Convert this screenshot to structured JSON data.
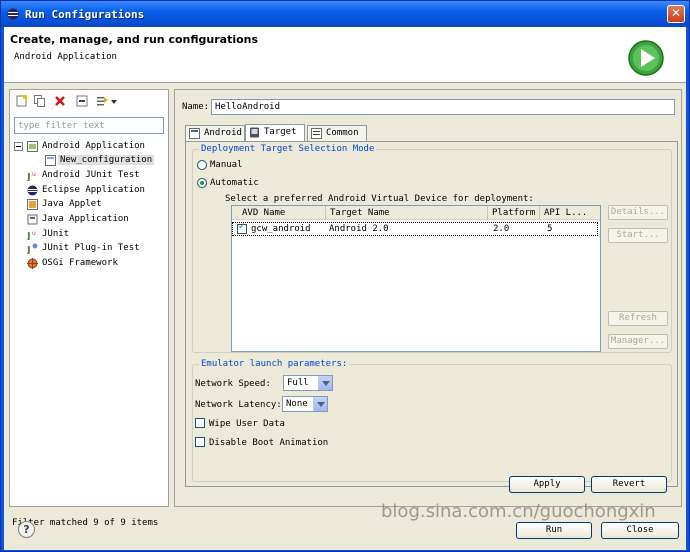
{
  "window": {
    "title": "Run Configurations",
    "close_symbol": "✕"
  },
  "header": {
    "title": "Create, manage, and run configurations",
    "subtitle": "Android Application"
  },
  "left": {
    "filter_placeholder": "type filter text",
    "tree": [
      {
        "label": "Android Application",
        "icon": "android-app-icon",
        "indent": 1,
        "expanded": true
      },
      {
        "label": "New_configuration",
        "icon": "config-icon",
        "indent": 2,
        "selected": true
      },
      {
        "label": "Android JUnit Test",
        "icon": "junit-icon",
        "indent": 1
      },
      {
        "label": "Eclipse Application",
        "icon": "eclipse-icon",
        "indent": 1
      },
      {
        "label": "Java Applet",
        "icon": "applet-icon",
        "indent": 1
      },
      {
        "label": "Java Application",
        "icon": "java-app-icon",
        "indent": 1
      },
      {
        "label": "JUnit",
        "icon": "junit-icon",
        "indent": 1
      },
      {
        "label": "JUnit Plug-in Test",
        "icon": "junit-plugin-icon",
        "indent": 1
      },
      {
        "label": "OSGi Framework",
        "icon": "osgi-icon",
        "indent": 1
      }
    ],
    "status": "Filter matched 9 of 9 items"
  },
  "config": {
    "name_label": "Name:",
    "name_value": "HelloAndroid",
    "tabs": [
      {
        "label": "Android",
        "active": false
      },
      {
        "label": "Target",
        "active": true
      },
      {
        "label": "Common",
        "active": false
      }
    ],
    "deployment": {
      "group_title": "Deployment Target Selection Mode",
      "manual_label": "Manual",
      "automatic_label": "Automatic",
      "selected": "automatic",
      "prompt": "Select a preferred Android Virtual Device for deployment:",
      "columns": [
        "AVD Name",
        "Target Name",
        "Platform",
        "API L..."
      ],
      "rows": [
        {
          "checked": true,
          "avd_name": "gcw_android",
          "target": "Android 2.0",
          "platform": "2.0",
          "api": "5"
        }
      ],
      "buttons": {
        "details": "Details...",
        "start": "Start...",
        "refresh": "Refresh",
        "manager": "Manager..."
      }
    },
    "emulator": {
      "group_title": "Emulator launch parameters:",
      "network_speed_label": "Network Speed:",
      "network_speed_value": "Full",
      "network_latency_label": "Network Latency:",
      "network_latency_value": "None",
      "wipe_label": "Wipe User Data",
      "wipe_checked": false,
      "disable_boot_label": "Disable Boot Animation",
      "disable_boot_checked": false
    },
    "apply_label": "Apply",
    "revert_label": "Revert"
  },
  "footer": {
    "run_label": "Run",
    "close_label": "Close",
    "help_symbol": "?",
    "watermark": "blog.sina.com.cn/guochongxin"
  }
}
